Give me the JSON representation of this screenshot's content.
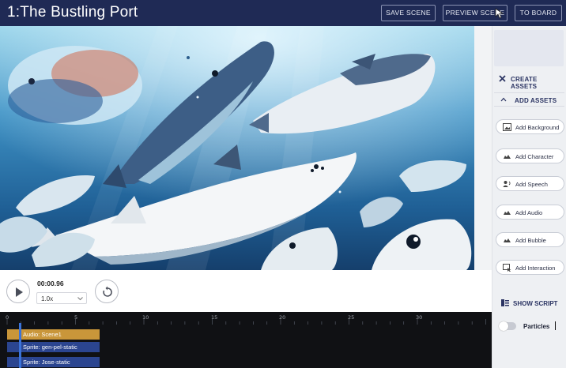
{
  "header": {
    "title": "1:The Bustling Port",
    "buttons": {
      "save": "SAVE SCENE",
      "preview": "PREVIEW SCENE",
      "board": "TO BOARD"
    }
  },
  "panel": {
    "create_assets": "CREATE ASSETS",
    "add_assets": "ADD ASSETS",
    "asset_buttons": [
      {
        "label": "Add Background",
        "icon": "image-icon"
      },
      {
        "label": "Add Character",
        "icon": "character-icon"
      },
      {
        "label": "Add Speech",
        "icon": "speech-icon"
      },
      {
        "label": "Add Audio",
        "icon": "audio-icon"
      },
      {
        "label": "Add Bubble",
        "icon": "bubble-icon"
      },
      {
        "label": "Add Interaction",
        "icon": "interaction-icon"
      }
    ],
    "show_script": "SHOW SCRIPT",
    "particles_label": "Particles"
  },
  "controls": {
    "time": "00:00.96",
    "speed": "1.0x"
  },
  "timeline": {
    "ticks": [
      "0",
      "5",
      "10",
      "15",
      "20",
      "25",
      "30"
    ],
    "tracks": [
      {
        "label": "Audio: Scene1",
        "kind": "audio"
      },
      {
        "label": "Sprite: gen-pel-static",
        "kind": "sprite"
      },
      {
        "label": "Sprite: Jose-static",
        "kind": "sprite"
      }
    ]
  },
  "colors": {
    "header_bg": "#1f2a55",
    "audio_track": "#c9963a",
    "sprite_track": "#2b4590",
    "playhead": "#3b73d9"
  }
}
